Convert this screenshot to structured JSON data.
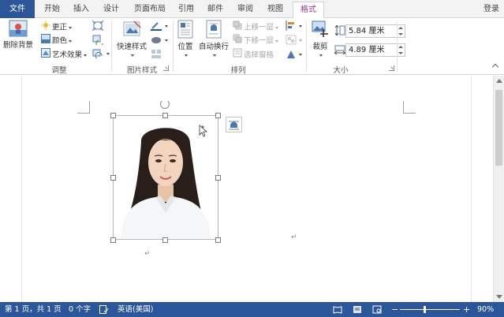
{
  "tabs": {
    "file": "文件",
    "home": "开始",
    "insert": "插入",
    "design": "设计",
    "layout": "页面布局",
    "references": "引用",
    "mailings": "邮件",
    "review": "审阅",
    "view": "视图",
    "format": "格式"
  },
  "login": "登录",
  "ribbon": {
    "adjust": {
      "remove_bg": "删除背景",
      "corrections": "更正",
      "color": "颜色",
      "artistic": "艺术效果",
      "group_label": "调整"
    },
    "picture_styles": {
      "quick_styles": "快速样式",
      "group_label": "图片样式"
    },
    "arrange": {
      "position": "位置",
      "wrap_text": "自动换行",
      "bring_forward": "上移一层",
      "send_backward": "下移一层",
      "selection_pane": "选择窗格",
      "group_label": "排列"
    },
    "size": {
      "crop": "裁剪",
      "height": "5.84 厘米",
      "width": "4.89 厘米",
      "group_label": "大小"
    }
  },
  "status": {
    "page": "第 1 页，共 1 页",
    "words": "0 个字",
    "language": "英语(美国)",
    "zoom": "90%",
    "zoom_level": 0.9
  },
  "colors": {
    "accent": "#2b579a",
    "active_tab": "#a0338e"
  }
}
